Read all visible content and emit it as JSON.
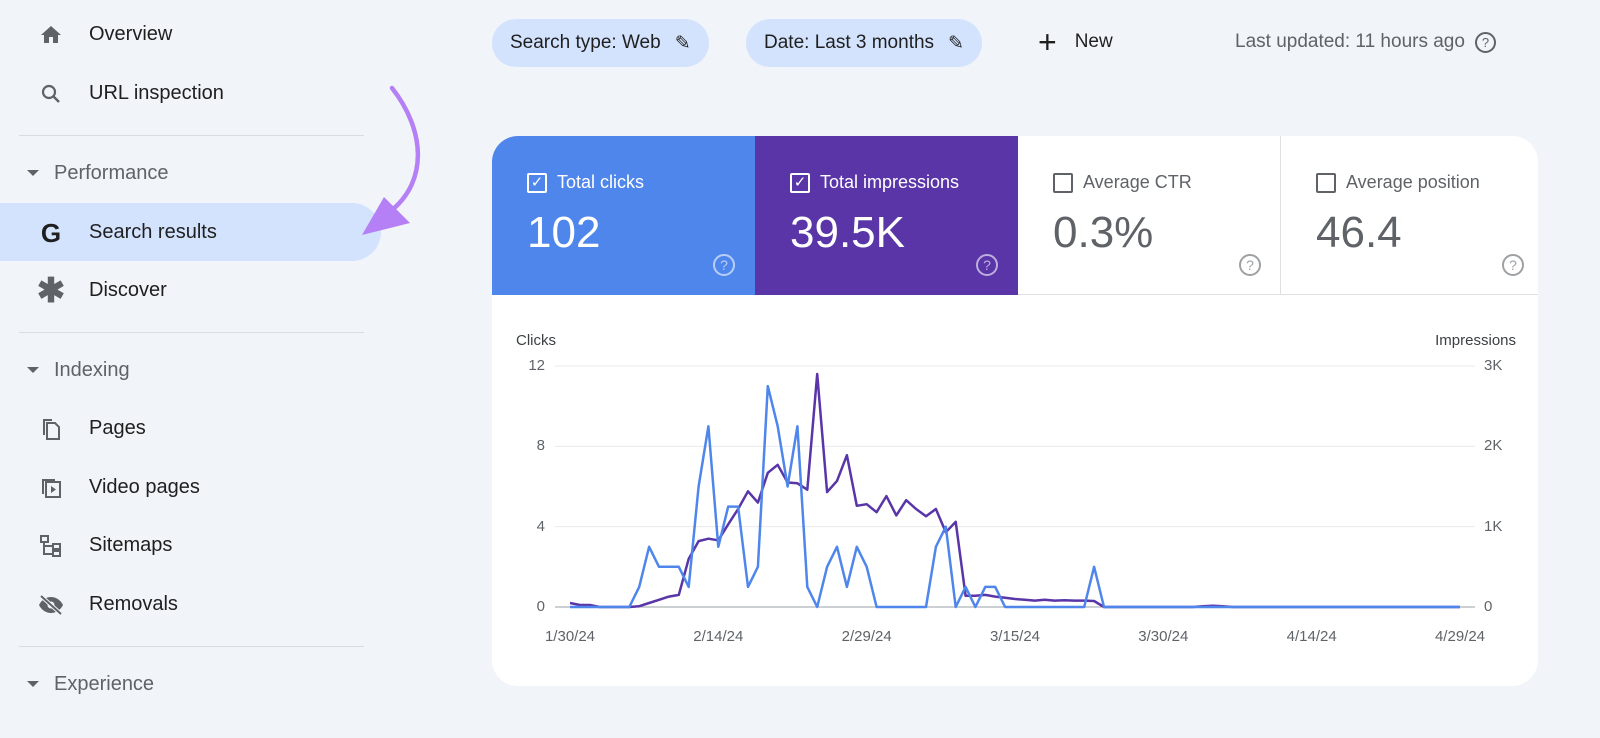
{
  "sidebar": {
    "items": [
      {
        "label": "Overview",
        "icon": "home-icon"
      },
      {
        "label": "URL inspection",
        "icon": "search-icon"
      }
    ],
    "sections": [
      {
        "label": "Performance",
        "items": [
          {
            "label": "Search results",
            "icon": "google-g-icon",
            "active": true
          },
          {
            "label": "Discover",
            "icon": "asterisk-icon"
          }
        ]
      },
      {
        "label": "Indexing",
        "items": [
          {
            "label": "Pages",
            "icon": "pages-icon"
          },
          {
            "label": "Video pages",
            "icon": "video-pages-icon"
          },
          {
            "label": "Sitemaps",
            "icon": "sitemap-icon"
          },
          {
            "label": "Removals",
            "icon": "eye-off-icon"
          }
        ]
      },
      {
        "label": "Experience"
      }
    ]
  },
  "toolbar": {
    "search_type": "Search type: Web",
    "date": "Date: Last 3 months",
    "new_label": "New",
    "last_updated": "Last updated: 11 hours ago"
  },
  "metrics": [
    {
      "label": "Total clicks",
      "value": "102",
      "checked": true,
      "color": "#4f86ec"
    },
    {
      "label": "Total impressions",
      "value": "39.5K",
      "checked": true,
      "color": "#5935a8"
    },
    {
      "label": "Average CTR",
      "value": "0.3%",
      "checked": false
    },
    {
      "label": "Average position",
      "value": "46.4",
      "checked": false
    }
  ],
  "colors": {
    "accent": "#d3e3fd",
    "clicks": "#4f86ec",
    "impressions": "#5935a8",
    "arrow": "#b57ff5"
  },
  "chart_data": {
    "type": "line",
    "left_axis": {
      "label": "Clicks",
      "ticks": [
        "12",
        "8",
        "4",
        "0"
      ],
      "range": [
        0,
        12
      ]
    },
    "right_axis": {
      "label": "Impressions",
      "ticks": [
        "3K",
        "2K",
        "1K",
        "0"
      ],
      "range": [
        0,
        3000
      ]
    },
    "x_ticks": [
      "1/30/24",
      "2/14/24",
      "2/29/24",
      "3/15/24",
      "3/30/24",
      "4/14/24",
      "4/29/24"
    ],
    "x": [
      "1/30/24",
      "1/31/24",
      "2/1/24",
      "2/2/24",
      "2/3/24",
      "2/4/24",
      "2/5/24",
      "2/6/24",
      "2/7/24",
      "2/8/24",
      "2/9/24",
      "2/10/24",
      "2/11/24",
      "2/12/24",
      "2/13/24",
      "2/14/24",
      "2/15/24",
      "2/16/24",
      "2/17/24",
      "2/18/24",
      "2/19/24",
      "2/20/24",
      "2/21/24",
      "2/22/24",
      "2/23/24",
      "2/24/24",
      "2/25/24",
      "2/26/24",
      "2/27/24",
      "2/28/24",
      "2/29/24",
      "3/1/24",
      "3/2/24",
      "3/3/24",
      "3/4/24",
      "3/5/24",
      "3/6/24",
      "3/7/24",
      "3/8/24",
      "3/9/24",
      "3/10/24",
      "3/11/24",
      "3/12/24",
      "3/13/24",
      "3/14/24",
      "3/15/24",
      "3/16/24",
      "3/17/24",
      "3/18/24",
      "3/19/24",
      "3/20/24",
      "3/21/24",
      "3/22/24",
      "3/23/24",
      "3/24/24",
      "3/25/24",
      "3/26/24",
      "3/27/24",
      "3/28/24",
      "3/29/24",
      "3/30/24",
      "3/31/24",
      "4/1/24",
      "4/2/24",
      "4/3/24",
      "4/4/24",
      "4/5/24",
      "4/6/24",
      "4/7/24",
      "4/8/24",
      "4/9/24",
      "4/10/24",
      "4/11/24",
      "4/12/24",
      "4/13/24",
      "4/14/24",
      "4/15/24",
      "4/16/24",
      "4/17/24",
      "4/18/24",
      "4/19/24",
      "4/20/24",
      "4/21/24",
      "4/22/24",
      "4/23/24",
      "4/24/24",
      "4/25/24",
      "4/26/24",
      "4/27/24",
      "4/28/24",
      "4/29/24"
    ],
    "series": [
      {
        "name": "Clicks",
        "axis": "left",
        "color": "#4f86ec",
        "values": [
          0,
          0,
          0,
          0,
          0,
          0,
          0,
          1,
          3,
          2,
          2,
          2,
          1,
          6,
          9,
          3,
          5,
          5,
          1,
          2,
          11,
          9,
          6,
          9,
          1,
          0,
          2,
          3,
          1,
          3,
          2,
          0,
          0,
          0,
          0,
          0,
          0,
          3,
          4,
          0,
          1,
          0,
          1,
          1,
          0,
          0,
          0,
          0,
          0,
          0,
          0,
          0,
          0,
          2,
          0,
          0,
          0,
          0,
          0,
          0,
          0,
          0,
          0,
          0,
          0,
          0,
          0,
          0,
          0,
          0,
          0,
          0,
          0,
          0,
          0,
          0,
          0,
          0,
          0,
          0,
          0,
          0,
          0,
          0,
          0,
          0,
          0,
          0,
          0,
          0,
          0
        ]
      },
      {
        "name": "Impressions",
        "axis": "right",
        "color": "#5935a8",
        "values": [
          50,
          25,
          25,
          0,
          0,
          0,
          0,
          10,
          50,
          90,
          130,
          150,
          600,
          820,
          850,
          830,
          1030,
          1220,
          1440,
          1300,
          1670,
          1770,
          1550,
          1540,
          1460,
          2900,
          1430,
          1570,
          1890,
          1260,
          1280,
          1180,
          1380,
          1140,
          1330,
          1220,
          1130,
          1220,
          930,
          1060,
          140,
          140,
          150,
          130,
          115,
          100,
          90,
          80,
          90,
          80,
          85,
          80,
          80,
          75,
          0,
          0,
          0,
          0,
          0,
          0,
          0,
          0,
          0,
          0,
          10,
          15,
          10,
          0,
          0,
          0,
          0,
          0,
          0,
          0,
          0,
          0,
          0,
          0,
          0,
          0,
          0,
          0,
          0,
          0,
          0,
          0,
          0,
          0,
          0,
          0,
          0
        ]
      }
    ],
    "grid": true
  }
}
